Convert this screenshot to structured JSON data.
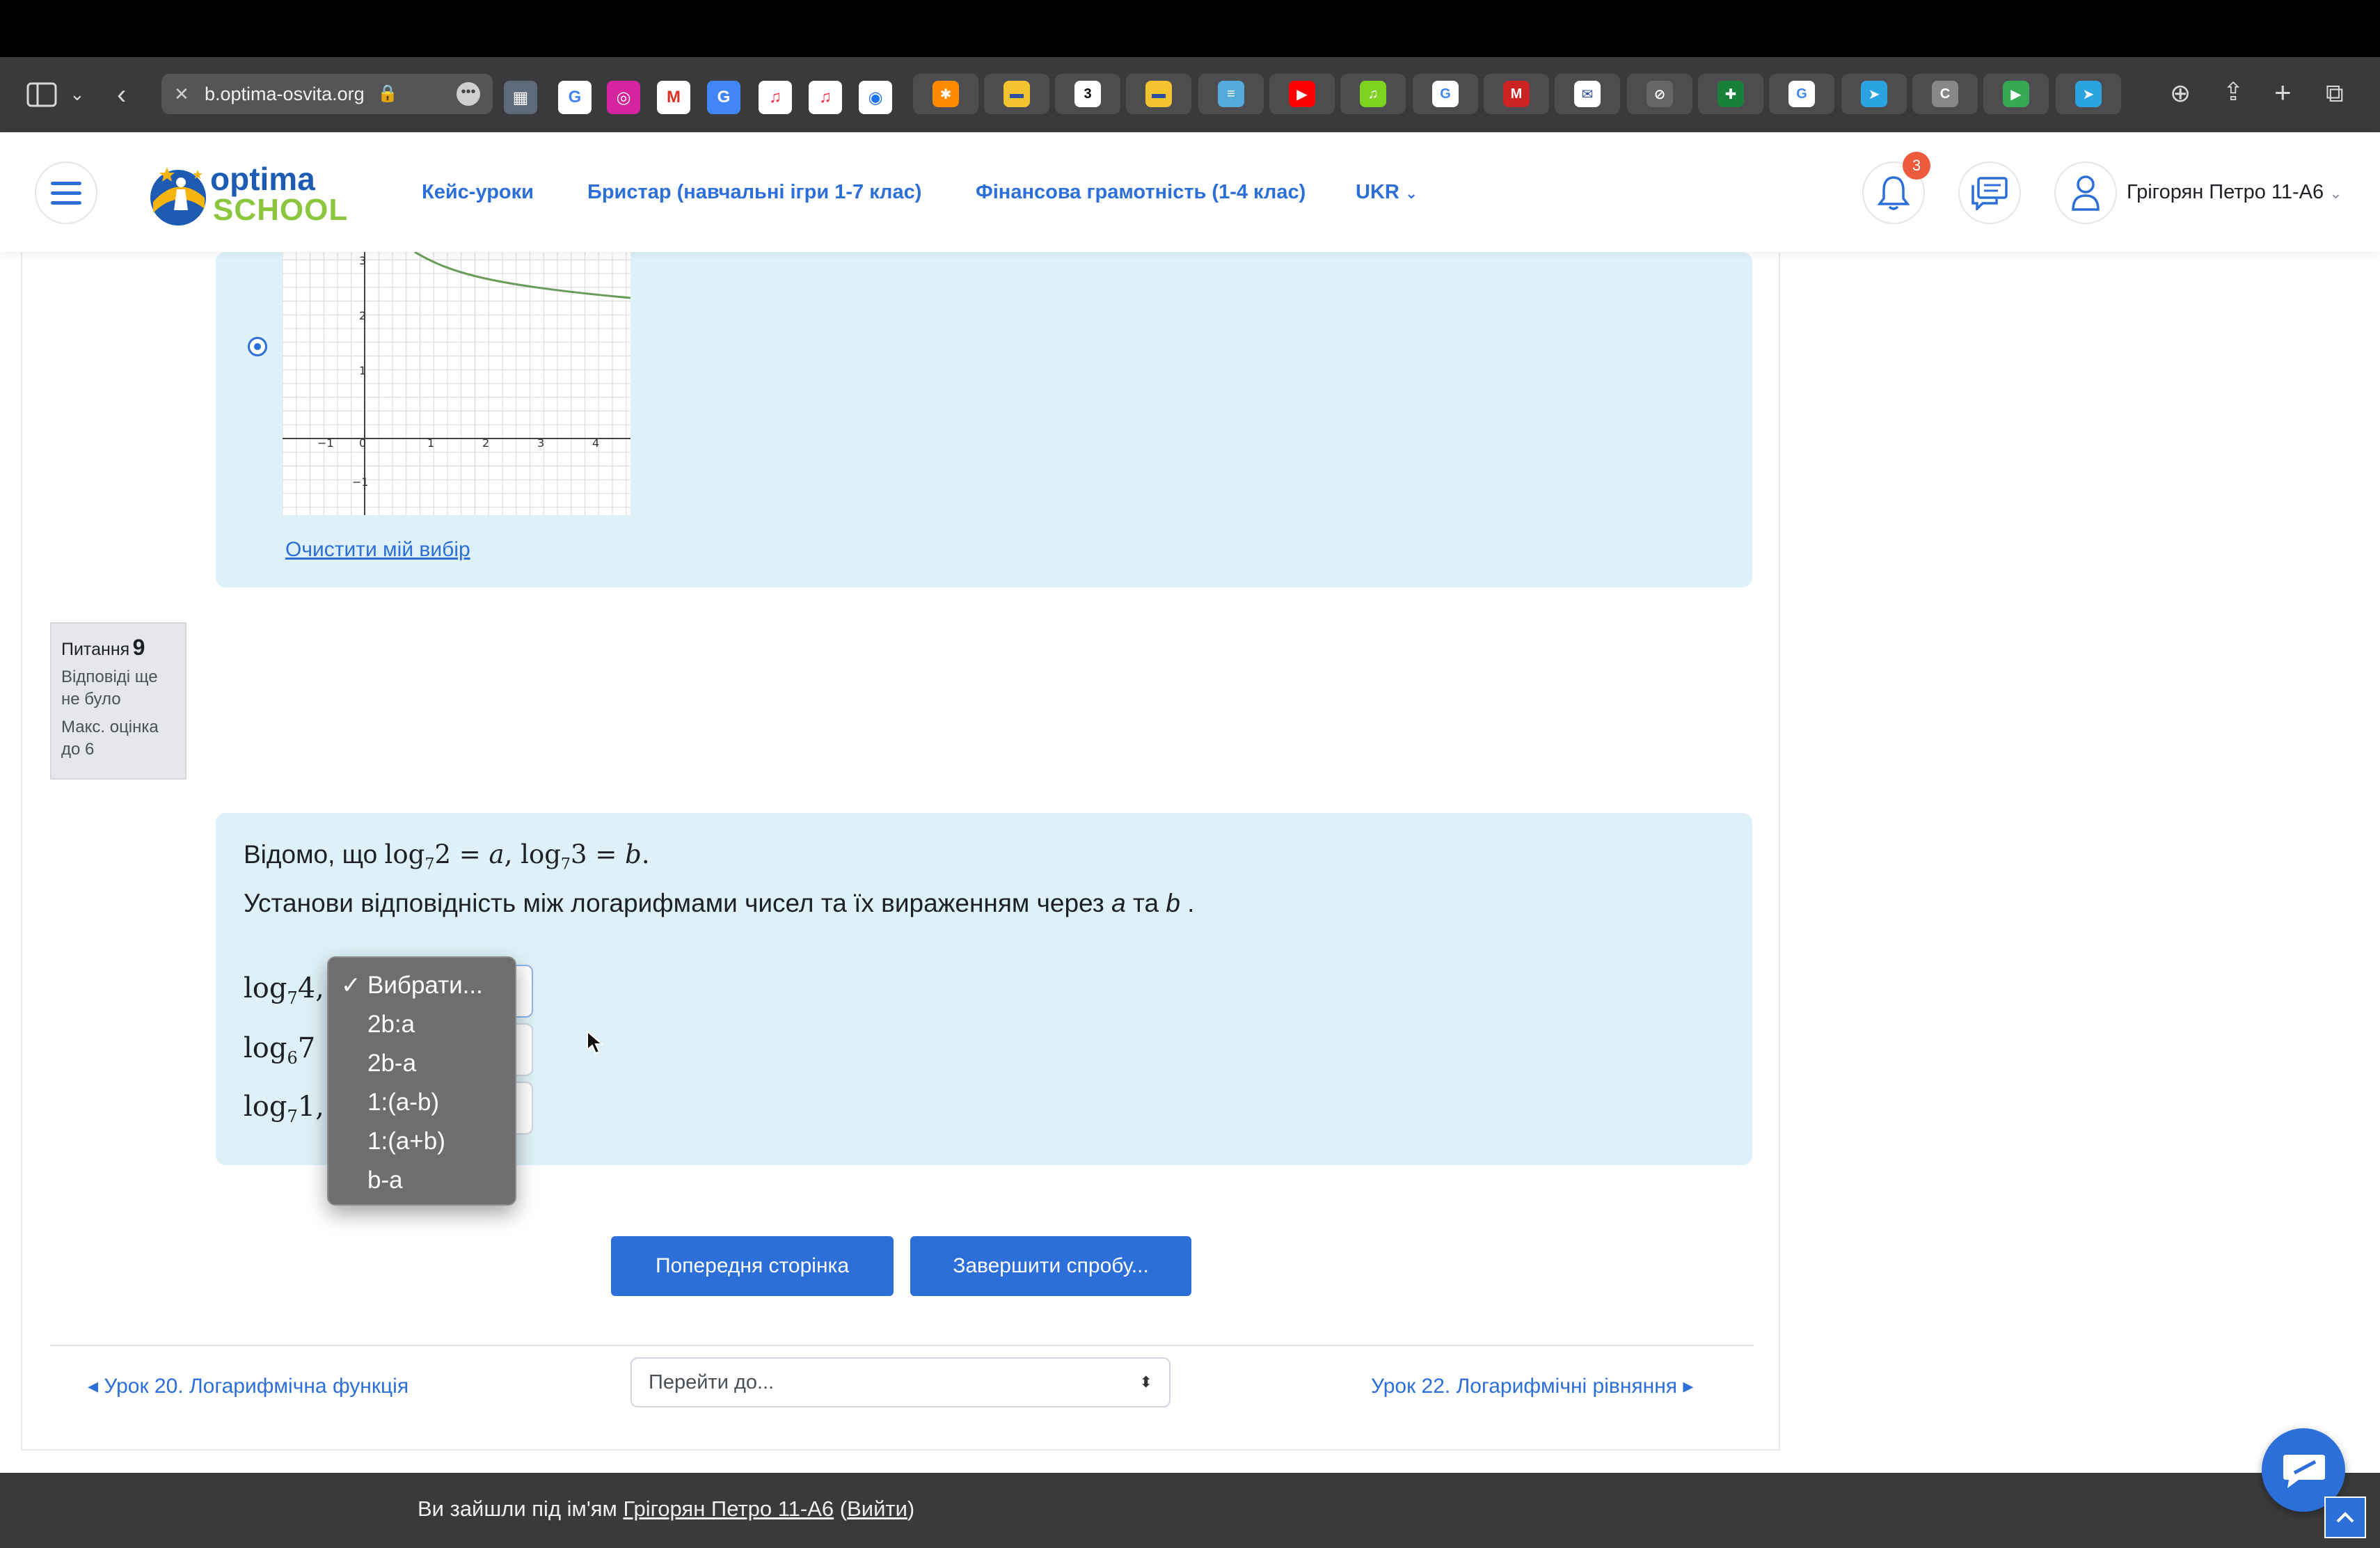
{
  "browser": {
    "url": "b.optima-osvita.org",
    "bookmark_icons": [
      "google",
      "instagram",
      "mail",
      "translate",
      "music",
      "music",
      "safari-compass"
    ],
    "tab_icons": [
      "folder",
      "folder",
      "folder-3",
      "folder",
      "folder",
      "youtube",
      "music",
      "google",
      "office",
      "mail",
      "safari",
      "sheets",
      "google",
      "telegram",
      "c",
      "play",
      "telegram"
    ]
  },
  "header": {
    "logo_text_top": "optima",
    "logo_text_bottom": "SCHOOL",
    "nav": [
      "Кейс-уроки",
      "Бристар (навчальні ігри 1-7 клас)",
      "Фінансова грамотність (1-4 клас)",
      "UKR"
    ],
    "notifications_count": "3",
    "user_name": "Грігорян Петро 11-А6"
  },
  "prev_question": {
    "graph": {
      "x_ticks": [
        "−1",
        "0",
        "1",
        "2",
        "3",
        "4"
      ],
      "y_ticks": [
        "3",
        "2",
        "1",
        "−1"
      ]
    },
    "clear_choice": "Очистити мій вибір"
  },
  "question": {
    "label": "Питання",
    "number": "9",
    "status": "Відповіді ще не було",
    "max_grade": "Макс. оцінка до 6",
    "intro_prefix": "Відомо, що",
    "instruction": "Установи відповідність між логарифмами чисел та їх вираженням через",
    "var_a": "a",
    "conj": "та",
    "var_b": "b",
    "end": ".",
    "rows": [
      {
        "base": "7",
        "arg": "4, 5"
      },
      {
        "base": "6",
        "arg": "7"
      },
      {
        "base": "7",
        "arg": "1, 5"
      }
    ],
    "dropdown": {
      "selected": "Вибрати...",
      "options": [
        "Вибрати...",
        "2b:a",
        "2b-a",
        "1:(a-b)",
        "1:(a+b)",
        "b-a"
      ]
    }
  },
  "actions": {
    "prev_page": "Попередня сторінка",
    "finish": "Завершити спробу..."
  },
  "navigation": {
    "prev_lesson": "◂ Урок 20. Логарифмічна функція",
    "jump_placeholder": "Перейти до...",
    "next_lesson": "Урок 22. Логарифмічні рівняння ▸"
  },
  "footer": {
    "prefix": "Ви зайшли під ім'ям",
    "user": "Грігорян Петро 11-А6",
    "logout": "Вийти"
  }
}
